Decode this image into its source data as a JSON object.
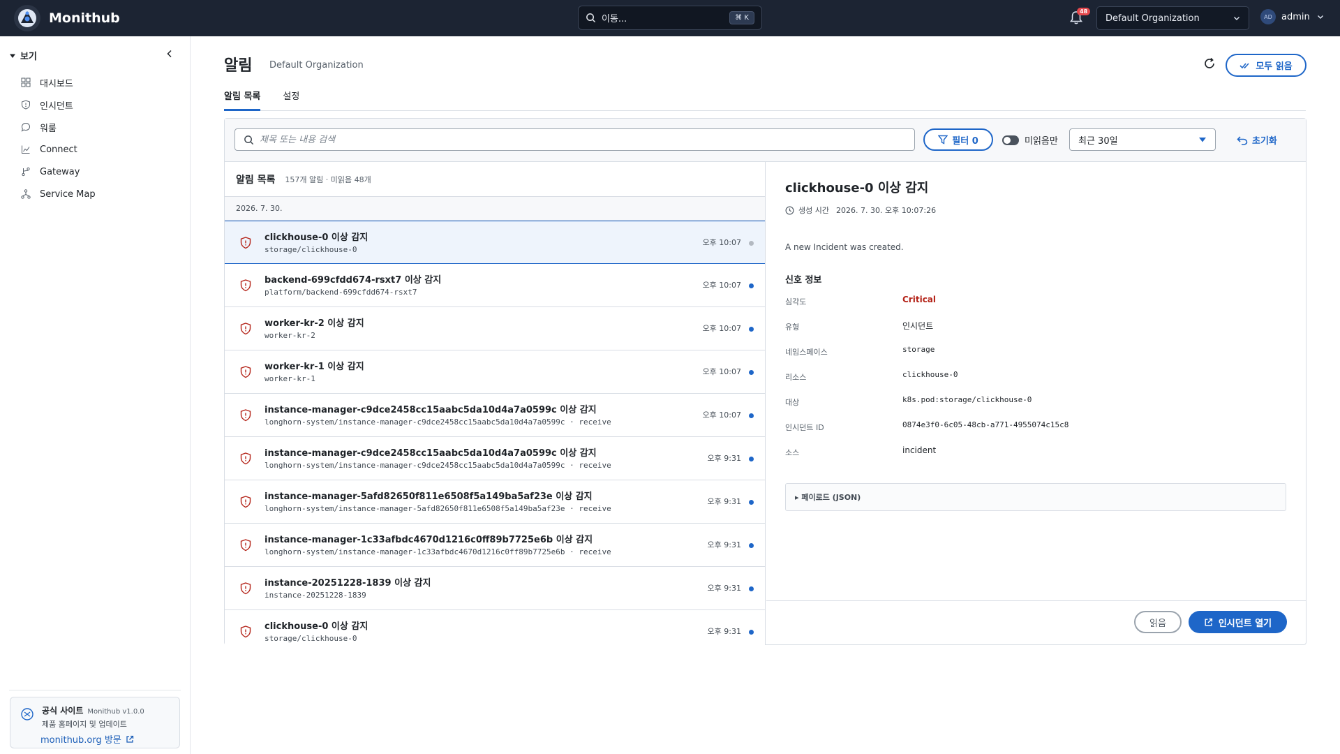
{
  "app": {
    "name": "Monithub",
    "search_label": "이동...",
    "search_shortcut": "⌘ K",
    "notification_count": "48",
    "org": "Default Organization",
    "avatar_initials": "AD",
    "user": "admin"
  },
  "sidebar": {
    "section": "보기",
    "items": [
      {
        "label": "대시보드",
        "icon": "dashboard-icon"
      },
      {
        "label": "인시던트",
        "icon": "shield-icon"
      },
      {
        "label": "워룸",
        "icon": "chat-icon"
      },
      {
        "label": "Connect",
        "icon": "chart-icon"
      },
      {
        "label": "Gateway",
        "icon": "branch-icon"
      },
      {
        "label": "Service Map",
        "icon": "network-icon"
      }
    ],
    "footer": {
      "title": "공식 사이트",
      "version": "Monithub v1.0.0",
      "subtitle": "제품 홈페이지 및 업데이트",
      "link": "monithub.org 방문"
    }
  },
  "page": {
    "title": "알림",
    "subtitle": "Default Organization",
    "read_all": "모두 읽음",
    "tabs": [
      {
        "label": "알림 목록",
        "active": true
      },
      {
        "label": "설정",
        "active": false
      }
    ]
  },
  "filters": {
    "search_placeholder": "제목 또는 내용 검색",
    "filter_label": "필터 0",
    "unread_only": "미읽음만",
    "range": "최근 30일",
    "reset": "초기화"
  },
  "list": {
    "title": "알림 목록",
    "count": "157개 알림 · 미읽음 48개",
    "date": "2026. 7. 30.",
    "rows": [
      {
        "title": "clickhouse-0 이상 감지",
        "path": "storage/clickhouse-0",
        "time": "오후 10:07",
        "read": true
      },
      {
        "title": "backend-699cfdd674-rsxt7 이상 감지",
        "path": "platform/backend-699cfdd674-rsxt7",
        "time": "오후 10:07",
        "read": false
      },
      {
        "title": "worker-kr-2 이상 감지",
        "path": "worker-kr-2",
        "time": "오후 10:07",
        "read": false
      },
      {
        "title": "worker-kr-1 이상 감지",
        "path": "worker-kr-1",
        "time": "오후 10:07",
        "read": false
      },
      {
        "title": "instance-manager-c9dce2458cc15aabc5da10d4a7a0599c 이상 감지",
        "path": "longhorn-system/instance-manager-c9dce2458cc15aabc5da10d4a7a0599c · receive",
        "time": "오후 10:07",
        "read": false
      },
      {
        "title": "instance-manager-c9dce2458cc15aabc5da10d4a7a0599c 이상 감지",
        "path": "longhorn-system/instance-manager-c9dce2458cc15aabc5da10d4a7a0599c · receive",
        "time": "오후 9:31",
        "read": false
      },
      {
        "title": "instance-manager-5afd82650f811e6508f5a149ba5af23e 이상 감지",
        "path": "longhorn-system/instance-manager-5afd82650f811e6508f5a149ba5af23e · receive",
        "time": "오후 9:31",
        "read": false
      },
      {
        "title": "instance-manager-1c33afbdc4670d1216c0ff89b7725e6b 이상 감지",
        "path": "longhorn-system/instance-manager-1c33afbdc4670d1216c0ff89b7725e6b · receive",
        "time": "오후 9:31",
        "read": false
      },
      {
        "title": "instance-20251228-1839 이상 감지",
        "path": "instance-20251228-1839",
        "time": "오후 9:31",
        "read": false
      },
      {
        "title": "clickhouse-0 이상 감지",
        "path": "storage/clickhouse-0",
        "time": "오후 9:31",
        "read": false
      }
    ]
  },
  "detail": {
    "title": "clickhouse-0 이상 감지",
    "created_label": "생성 시간",
    "created_value": "2026. 7. 30. 오후 10:07:26",
    "description": "A new Incident was created.",
    "section": "신호 정보",
    "fields": [
      {
        "key": "심각도",
        "value": "Critical"
      },
      {
        "key": "유형",
        "value": "인시던트"
      },
      {
        "key": "네임스페이스",
        "value": "storage"
      },
      {
        "key": "리소스",
        "value": "clickhouse-0"
      },
      {
        "key": "대상",
        "value": "k8s.pod:storage/clickhouse-0"
      },
      {
        "key": "인시던트 ID",
        "value": "0874e3f0-6c05-48cb-a771-4955074c15c8"
      },
      {
        "key": "소스",
        "value": "incident"
      }
    ],
    "payload": "▸ 페이로드 (JSON)",
    "read_btn": "읽음",
    "open_btn": "인시던트 열기"
  },
  "colors": {
    "accent": "#1e66c8",
    "critical": "#b42318",
    "topbar": "#1c2433"
  }
}
